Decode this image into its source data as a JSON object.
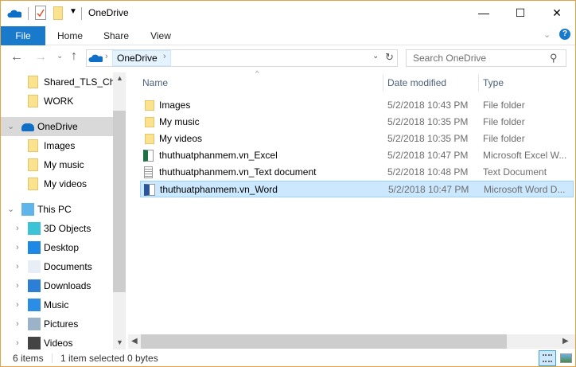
{
  "title": "OneDrive",
  "window_controls": {
    "minimize": "—",
    "maximize": "☐",
    "close": "✕"
  },
  "ribbon": {
    "tabs": [
      "File",
      "Home",
      "Share",
      "View"
    ]
  },
  "address": {
    "location": "OneDrive",
    "search_placeholder": "Search OneDrive"
  },
  "nav": {
    "items": [
      {
        "label": "Shared_TLS_Cha",
        "icon": "shared-folder-icon"
      },
      {
        "label": "WORK",
        "icon": "folder-synced-icon"
      },
      {
        "label": "OneDrive",
        "icon": "onedrive-icon"
      },
      {
        "label": "Images",
        "icon": "folder-icon"
      },
      {
        "label": "My music",
        "icon": "folder-icon"
      },
      {
        "label": "My videos",
        "icon": "folder-icon"
      },
      {
        "label": "This PC",
        "icon": "computer-icon"
      },
      {
        "label": "3D Objects",
        "icon": "3d-objects-icon"
      },
      {
        "label": "Desktop",
        "icon": "desktop-icon"
      },
      {
        "label": "Documents",
        "icon": "documents-icon"
      },
      {
        "label": "Downloads",
        "icon": "downloads-icon"
      },
      {
        "label": "Music",
        "icon": "music-icon"
      },
      {
        "label": "Pictures",
        "icon": "pictures-icon"
      },
      {
        "label": "Videos",
        "icon": "videos-icon"
      }
    ]
  },
  "columns": [
    "Name",
    "Date modified",
    "Type"
  ],
  "files": [
    {
      "name": "Images",
      "date": "5/2/2018 10:43 PM",
      "type": "File folder",
      "icon": "folder"
    },
    {
      "name": "My music",
      "date": "5/2/2018 10:35 PM",
      "type": "File folder",
      "icon": "folder"
    },
    {
      "name": "My videos",
      "date": "5/2/2018 10:35 PM",
      "type": "File folder",
      "icon": "folder"
    },
    {
      "name": "thuthuatphanmem.vn_Excel",
      "date": "5/2/2018 10:47 PM",
      "type": "Microsoft Excel W...",
      "icon": "excel"
    },
    {
      "name": "thuthuatphanmem.vn_Text document",
      "date": "5/2/2018 10:48 PM",
      "type": "Text Document",
      "icon": "text"
    },
    {
      "name": "thuthuatphanmem.vn_Word",
      "date": "5/2/2018 10:47 PM",
      "type": "Microsoft Word D...",
      "icon": "word"
    }
  ],
  "status": {
    "count": "6 items",
    "selected": "1 item selected",
    "size": "0 bytes"
  },
  "colors": {
    "accent": "#1979ca",
    "selection": "#cce8ff"
  }
}
